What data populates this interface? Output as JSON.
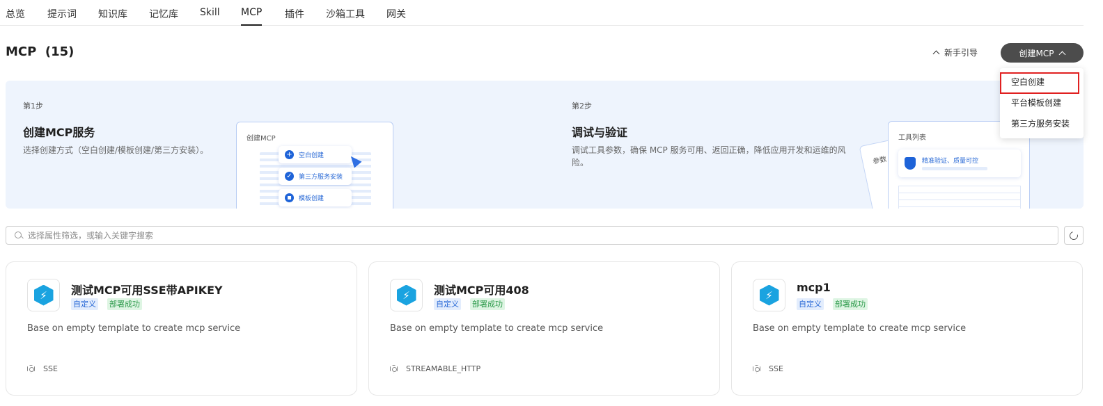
{
  "tabs": [
    "总览",
    "提示词",
    "知识库",
    "记忆库",
    "Skill",
    "MCP",
    "插件",
    "沙箱工具",
    "网关"
  ],
  "active_tab": "MCP",
  "header": {
    "title": "MCP  (15)",
    "guide_label": "新手引导",
    "create_label": "创建MCP"
  },
  "dropdown": {
    "items": [
      "空白创建",
      "平台模板创建",
      "第三方服务安装"
    ],
    "highlighted": "空白创建"
  },
  "banner": {
    "step1": {
      "no": "第1步",
      "title": "创建MCP服务",
      "desc": "选择创建方式（空白创建/模板创建/第三方安装）。",
      "illustration_title": "创建MCP",
      "options": [
        "空白创建",
        "第三方服务安装",
        "模板创建"
      ]
    },
    "step2": {
      "no": "第2步",
      "title": "调试与验证",
      "desc_line1": "调试工具参数，确保 MCP 服务可用、返回正确，降低应用开发和运维的风",
      "desc_line2": "险。",
      "illustration_title": "工具列表",
      "illustration_back": "参数",
      "card_text": "精准验证、质量可控"
    }
  },
  "search": {
    "placeholder": "选择属性筛选，或输入关键字搜索",
    "value": ""
  },
  "cards": [
    {
      "title": "测试MCP可用SSE带APIKEY",
      "tag1": "自定义",
      "tag2": "部署成功",
      "desc": "Base on empty template to create mcp service",
      "protocol": "SSE"
    },
    {
      "title": "测试MCP可用408",
      "tag1": "自定义",
      "tag2": "部署成功",
      "desc": "Base on empty template to create mcp service",
      "protocol": "STREAMABLE_HTTP"
    },
    {
      "title": "mcp1",
      "tag1": "自定义",
      "tag2": "部署成功",
      "desc": "Base on empty template to create mcp service",
      "protocol": "SSE"
    }
  ],
  "icons": {
    "search": "search-icon",
    "refresh": "refresh-icon",
    "mcp": "lightning-hexagon-icon",
    "protocol": "hexagon-icon"
  },
  "colors": {
    "create_button": "#4c4c4c",
    "highlight_border": "#e02020",
    "banner_bg": "#eef4fd",
    "tag_custom": "#2a6ad6",
    "tag_ok": "#2e9b4c",
    "mcp_icon": "#1aa3e0"
  }
}
